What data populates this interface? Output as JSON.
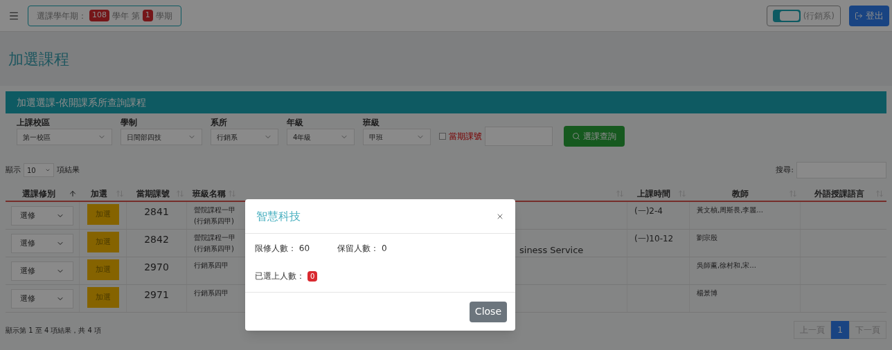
{
  "topbar": {
    "semester": {
      "prefix": "選課學年期：",
      "year": "108",
      "middle": "學年 第",
      "term": "1",
      "suffix": "學期"
    },
    "dept_switch": {
      "on": true,
      "label": "(行銷系)"
    },
    "logout": "登出"
  },
  "page_title": "加選課程",
  "panel": {
    "title": "加選選課-依開課系所查詢課程",
    "filters": [
      {
        "label": "上課校區",
        "value": "第一校區"
      },
      {
        "label": "學制",
        "value": "日間部四技"
      },
      {
        "label": "系所",
        "value": "行銷系"
      },
      {
        "label": "年級",
        "value": "4年級"
      },
      {
        "label": "班級",
        "value": "甲班"
      }
    ],
    "course_no": {
      "checked": false,
      "label": "當期課號"
    },
    "search_button": "選課查詢"
  },
  "table_controls": {
    "show": "顯示",
    "page_size": "10",
    "results": "項結果",
    "search_label": "搜尋:"
  },
  "table": {
    "columns": [
      {
        "label": "選課修別",
        "sorted": true
      },
      {
        "label": "加選",
        "sorted": false
      },
      {
        "label": "當期課號",
        "sorted": false
      },
      {
        "label": "班級名稱",
        "sorted": false
      },
      {
        "sorted": false
      },
      {
        "label": "上課時間",
        "sorted": false
      },
      {
        "label": "教師",
        "sorted": false
      },
      {
        "label": "外語授課語言",
        "sorted": false
      }
    ],
    "rows": [
      {
        "type": "選修",
        "add": "加選",
        "course_no": "2841",
        "class_name": [
          "營院課程一甲",
          "(行銷系四甲)"
        ],
        "time": "(一)2-4",
        "teacher": "黃文楨,周斯畏,李麗..."
      },
      {
        "type": "選修",
        "add": "加選",
        "course_no": "2842",
        "class_name": [
          "營院課程一甲",
          "(行銷系四甲)"
        ],
        "column_5": "siness Service",
        "time": "(一)10-12",
        "teacher": "劉宗殷"
      },
      {
        "type": "選修",
        "add": "加選",
        "course_no": "2970",
        "class_name": [
          "行銷系四甲"
        ],
        "teacher": "吳師薰,徐村和,宋..."
      },
      {
        "type": "選修",
        "add": "加選",
        "course_no": "2971",
        "class_name": [
          "行銷系四甲"
        ],
        "teacher": "楊景博"
      }
    ]
  },
  "footer": {
    "summary": "顯示第 1 至 4 項結果，共 4 項",
    "pages": [
      {
        "label": "上一頁",
        "selected": false
      },
      {
        "label": "1",
        "selected": true
      },
      {
        "label": "下一頁",
        "selected": false
      }
    ]
  },
  "modal": {
    "title": "智慧科技",
    "fields": [
      {
        "label": "限修人數：",
        "value": "60"
      },
      {
        "label": "保留人數：",
        "value": "0"
      }
    ],
    "enrolled": {
      "label": "已選上人數：",
      "value": "0"
    },
    "close_button": "Close"
  }
}
